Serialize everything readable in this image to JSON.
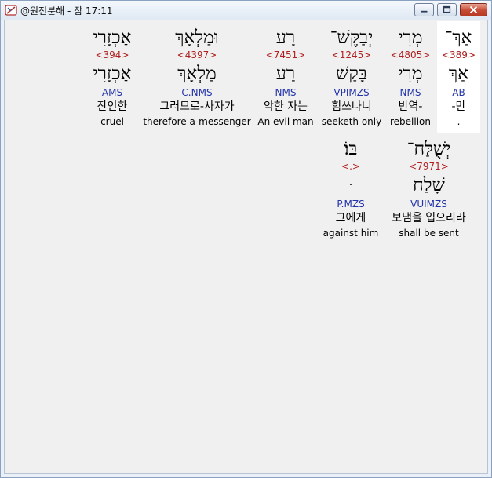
{
  "window": {
    "title": "@원전분해 - 잠 17:11"
  },
  "row1": [
    {
      "surface": "אַךְ־",
      "strong": "<389>",
      "lemma": "אַךְ",
      "parse": "AB",
      "kor": "-만",
      "eng": "."
    },
    {
      "surface": "מְרִי",
      "strong": "<4805>",
      "lemma": "מְרִי",
      "parse": "NMS",
      "kor": "반역-",
      "eng": "rebellion"
    },
    {
      "surface": "יְבַקֶּשׁ־",
      "strong": "<1245>",
      "lemma": "בָּקַשׁ",
      "parse": "VPIMZS",
      "kor": "힘쓰나니",
      "eng": "seeketh only"
    },
    {
      "surface": "רָע",
      "strong": "<7451>",
      "lemma": "רַע",
      "parse": "NMS",
      "kor": "악한 자는",
      "eng": "An evil man"
    },
    {
      "surface": "וּמַלְאָךְ",
      "strong": "<4397>",
      "lemma": "מַלְאָךְ",
      "parse": "C.NMS",
      "kor": "그러므로-사자가",
      "eng": "therefore a-messenger"
    },
    {
      "surface": "אַכְזָרִי",
      "strong": "<394>",
      "lemma": "אַכְזָרִי",
      "parse": "AMS",
      "kor": "잔인한",
      "eng": "cruel"
    }
  ],
  "row2": [
    {
      "surface": "יְשֻׁלַּח־",
      "strong": "<7971>",
      "lemma": "שָׁלַח",
      "parse": "VUIMZS",
      "kor": "보냄을 입으리라",
      "eng": "shall be sent"
    },
    {
      "surface": "בּוֹ׃",
      "strong": "<.>",
      "lemma": "ּ",
      "parse": "P.MZS",
      "kor": "그에게",
      "eng": "against him"
    }
  ]
}
